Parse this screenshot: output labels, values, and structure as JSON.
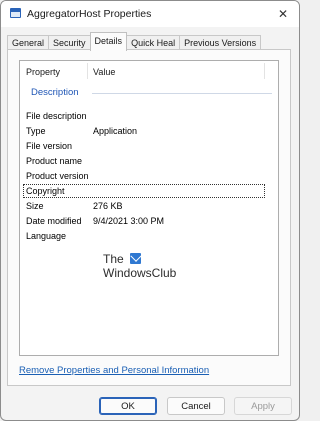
{
  "window": {
    "title": "AggregatorHost Properties",
    "close_glyph": "✕"
  },
  "tabs": [
    {
      "label": "General"
    },
    {
      "label": "Security"
    },
    {
      "label": "Details",
      "active": true
    },
    {
      "label": "Quick Heal"
    },
    {
      "label": "Previous Versions"
    }
  ],
  "details": {
    "columns": {
      "property": "Property",
      "value": "Value"
    },
    "group": "Description",
    "rows": [
      {
        "property": "File description",
        "value": ""
      },
      {
        "property": "Type",
        "value": "Application"
      },
      {
        "property": "File version",
        "value": ""
      },
      {
        "property": "Product name",
        "value": ""
      },
      {
        "property": "Product version",
        "value": ""
      },
      {
        "property": "Copyright",
        "value": "",
        "focused": true
      },
      {
        "property": "Size",
        "value": "276 KB"
      },
      {
        "property": "Date modified",
        "value": "9/4/2021 3:00 PM"
      },
      {
        "property": "Language",
        "value": ""
      }
    ]
  },
  "watermark": {
    "line1": "The",
    "line2": "WindowsClub"
  },
  "remove_link": "Remove Properties and Personal Information",
  "buttons": {
    "ok": "OK",
    "cancel": "Cancel",
    "apply": "Apply"
  }
}
